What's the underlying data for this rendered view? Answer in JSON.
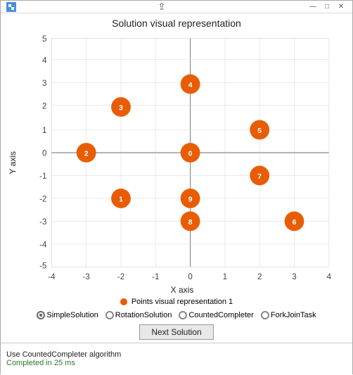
{
  "window": {
    "title": "",
    "chart_title": "Solution visual representation",
    "y_axis_label": "Y axis",
    "x_axis_label": "X axis"
  },
  "legend": {
    "dot_color": "#e85d04",
    "label": "Points visual representation 1"
  },
  "radio_options": [
    {
      "label": "SimpleSolution",
      "selected": true
    },
    {
      "label": "RotationSolution",
      "selected": false
    },
    {
      "label": "CountedCompleter",
      "selected": false
    },
    {
      "label": "ForkJoinTask",
      "selected": false
    }
  ],
  "next_button": "Next Solution",
  "status": {
    "line1": "Use CountedCompleter algorithm",
    "line2": "Completed in 25 ms"
  },
  "points": [
    {
      "id": "0",
      "x": 0,
      "y": 0
    },
    {
      "id": "1",
      "x": -2,
      "y": -2
    },
    {
      "id": "2",
      "x": -3,
      "y": 0
    },
    {
      "id": "3",
      "x": -2,
      "y": 2
    },
    {
      "id": "4",
      "x": 0,
      "y": 3
    },
    {
      "id": "5",
      "x": 2,
      "y": 1
    },
    {
      "id": "6",
      "x": 3,
      "y": -3
    },
    {
      "id": "7",
      "x": 2,
      "y": -1
    },
    {
      "id": "8",
      "x": 0,
      "y": -3
    },
    {
      "id": "9",
      "x": 0,
      "y": -2
    }
  ],
  "axes": {
    "x_min": -4,
    "x_max": 4,
    "y_min": -5,
    "y_max": 5,
    "x_ticks": [
      -4,
      -3,
      -2,
      -1,
      0,
      1,
      2,
      3,
      4
    ],
    "y_ticks": [
      -5,
      -4,
      -3,
      -2,
      -1,
      0,
      1,
      2,
      3,
      4,
      5
    ]
  }
}
